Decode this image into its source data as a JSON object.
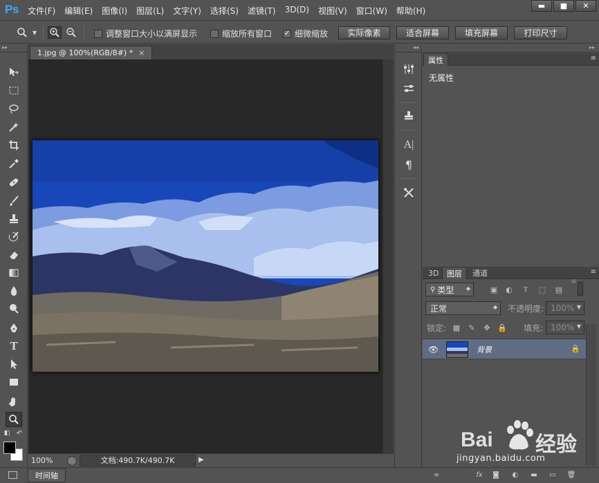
{
  "app": {
    "logo": "Ps"
  },
  "menu": [
    "文件(F)",
    "编辑(E)",
    "图像(I)",
    "图层(L)",
    "文字(Y)",
    "选择(S)",
    "滤镜(T)",
    "3D(D)",
    "视图(V)",
    "窗口(W)",
    "帮助(H)"
  ],
  "window_controls": {
    "minimize": "▬",
    "maximize": "■",
    "close": "✕"
  },
  "options": {
    "chk_resize_label": "调整窗口大小以满屏显示",
    "chk_zoom_all_label": "缩放所有窗口",
    "chk_scrubby_label": "细微缩放",
    "chk_scrubby_mark": "✓",
    "btn_actual_pixels": "实际像素",
    "btn_fit_screen": "适合屏幕",
    "btn_fill_screen": "填充屏幕",
    "btn_print_size": "打印尺寸"
  },
  "document": {
    "tab_title": "1.jpg @ 100%(RGB/8#) *",
    "tab_close": "×",
    "zoom": "100%",
    "doc_info": "文档:490.7K/490.7K",
    "status_arrow": "▶"
  },
  "timeline": {
    "label": "时间轴"
  },
  "properties": {
    "tab": "属性",
    "body": "无属性"
  },
  "layers_panel": {
    "tabs": [
      "3D",
      "图层",
      "通道"
    ],
    "filter_kind": "类型",
    "blend_mode": "正常",
    "opacity_label": "不透明度:",
    "opacity_value": "100%",
    "lock_label": "锁定:",
    "fill_label": "填充:",
    "fill_value": "100%",
    "layer_name": "背景",
    "panel_menu": "≡"
  },
  "watermark": {
    "bai": "Bai",
    "du": "经验",
    "url": "jingyan.baidu.com"
  },
  "colors": {
    "panel": "#535353",
    "canvas": "#282828",
    "selected_layer": "#5f6d84",
    "ps_blue": "#3fa9f5"
  },
  "icons": {
    "zoom_tool": "magnifier-icon",
    "move_tool": "move-icon",
    "eye": "eye-icon",
    "lock": "lock-icon"
  }
}
